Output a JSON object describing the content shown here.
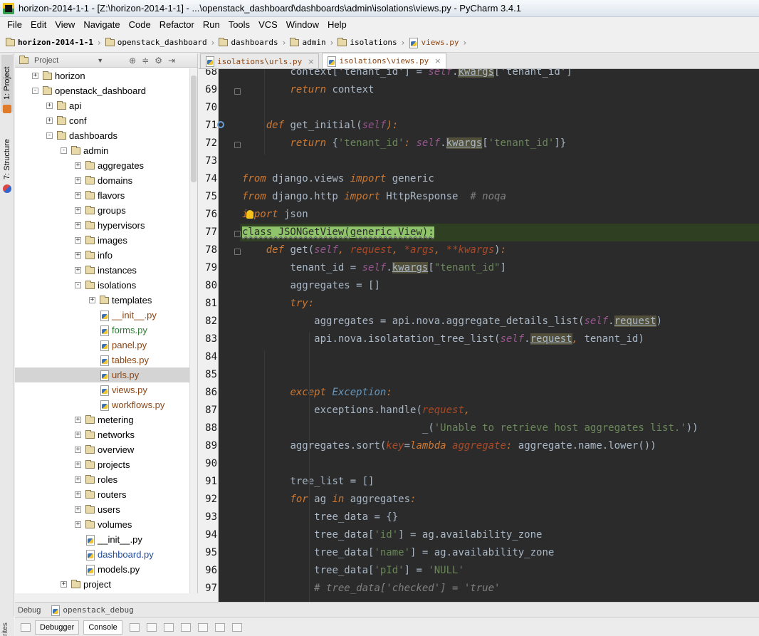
{
  "window": {
    "title": "horizon-2014-1-1 - [Z:\\horizon-2014-1-1] - ...\\openstack_dashboard\\dashboards\\admin\\isolations\\views.py - PyCharm 3.4.1"
  },
  "menu": [
    "File",
    "Edit",
    "View",
    "Navigate",
    "Code",
    "Refactor",
    "Run",
    "Tools",
    "VCS",
    "Window",
    "Help"
  ],
  "breadcrumb": [
    "horizon-2014-1-1",
    "openstack_dashboard",
    "dashboards",
    "admin",
    "isolations",
    "views.py"
  ],
  "left_strip": {
    "project_tab": "1: Project",
    "structure_tab": "7: Structure",
    "bottom_label": "rites"
  },
  "project_panel": {
    "title": "Project",
    "tree": [
      {
        "label": "horizon",
        "type": "folder",
        "depth": 1,
        "expander": "+"
      },
      {
        "label": "openstack_dashboard",
        "type": "folder",
        "depth": 1,
        "expander": "-"
      },
      {
        "label": "api",
        "type": "folder",
        "depth": 2,
        "expander": "+"
      },
      {
        "label": "conf",
        "type": "folder",
        "depth": 2,
        "expander": "+"
      },
      {
        "label": "dashboards",
        "type": "folder",
        "depth": 2,
        "expander": "-"
      },
      {
        "label": "admin",
        "type": "folder",
        "depth": 3,
        "expander": "-"
      },
      {
        "label": "aggregates",
        "type": "folder",
        "depth": 4,
        "expander": "+"
      },
      {
        "label": "domains",
        "type": "folder",
        "depth": 4,
        "expander": "+"
      },
      {
        "label": "flavors",
        "type": "folder",
        "depth": 4,
        "expander": "+"
      },
      {
        "label": "groups",
        "type": "folder",
        "depth": 4,
        "expander": "+"
      },
      {
        "label": "hypervisors",
        "type": "folder",
        "depth": 4,
        "expander": "+"
      },
      {
        "label": "images",
        "type": "folder",
        "depth": 4,
        "expander": "+"
      },
      {
        "label": "info",
        "type": "folder",
        "depth": 4,
        "expander": "+"
      },
      {
        "label": "instances",
        "type": "folder",
        "depth": 4,
        "expander": "+"
      },
      {
        "label": "isolations",
        "type": "folder",
        "depth": 4,
        "expander": "-"
      },
      {
        "label": "templates",
        "type": "folder",
        "depth": 5,
        "expander": "+"
      },
      {
        "label": "__init__.py",
        "type": "file",
        "depth": 5,
        "color": "#8b4513"
      },
      {
        "label": "forms.py",
        "type": "file",
        "depth": 5,
        "color": "#2e7d32"
      },
      {
        "label": "panel.py",
        "type": "file",
        "depth": 5,
        "color": "#8b4513"
      },
      {
        "label": "tables.py",
        "type": "file",
        "depth": 5,
        "color": "#8b4513"
      },
      {
        "label": "urls.py",
        "type": "file",
        "depth": 5,
        "color": "#8b4513",
        "selected": true
      },
      {
        "label": "views.py",
        "type": "file",
        "depth": 5,
        "color": "#8b4513"
      },
      {
        "label": "workflows.py",
        "type": "file",
        "depth": 5,
        "color": "#8b4513"
      },
      {
        "label": "metering",
        "type": "folder",
        "depth": 4,
        "expander": "+"
      },
      {
        "label": "networks",
        "type": "folder",
        "depth": 4,
        "expander": "+"
      },
      {
        "label": "overview",
        "type": "folder",
        "depth": 4,
        "expander": "+"
      },
      {
        "label": "projects",
        "type": "folder",
        "depth": 4,
        "expander": "+"
      },
      {
        "label": "roles",
        "type": "folder",
        "depth": 4,
        "expander": "+"
      },
      {
        "label": "routers",
        "type": "folder",
        "depth": 4,
        "expander": "+"
      },
      {
        "label": "users",
        "type": "folder",
        "depth": 4,
        "expander": "+"
      },
      {
        "label": "volumes",
        "type": "folder",
        "depth": 4,
        "expander": "+"
      },
      {
        "label": "__init__.py",
        "type": "file",
        "depth": 4,
        "color": "#000000"
      },
      {
        "label": "dashboard.py",
        "type": "file",
        "depth": 4,
        "color": "#1f4e9c"
      },
      {
        "label": "models.py",
        "type": "file",
        "depth": 4,
        "color": "#000000"
      },
      {
        "label": "project",
        "type": "folder",
        "depth": 3,
        "expander": "+"
      }
    ]
  },
  "editor_tabs": [
    {
      "label": "isolations\\urls.py",
      "active": false
    },
    {
      "label": "isolations\\views.py",
      "active": true
    }
  ],
  "code": {
    "highlight_line": 77,
    "lines": [
      {
        "n": "68",
        "indent": 2,
        "tokens": [
          [
            "t",
            "context['tenant_id'] = "
          ],
          [
            "self",
            "self"
          ],
          [
            "t",
            "."
          ],
          [
            "ulw",
            "kwargs"
          ],
          [
            "t",
            "['tenant_id']"
          ]
        ]
      },
      {
        "n": "69",
        "indent": 2,
        "fold": true,
        "tokens": [
          [
            "kw",
            "return"
          ],
          [
            "t",
            " context"
          ]
        ]
      },
      {
        "n": "70",
        "indent": 0,
        "tokens": []
      },
      {
        "n": "71",
        "indent": 1,
        "mark": true,
        "tokens": [
          [
            "kw",
            "def"
          ],
          [
            "t",
            " get_initial("
          ],
          [
            "self",
            "self"
          ],
          [
            "kw",
            ")"
          ],
          [
            "kw",
            ":"
          ]
        ]
      },
      {
        "n": "72",
        "indent": 2,
        "fold": true,
        "tokens": [
          [
            "kw",
            "return"
          ],
          [
            "t",
            " {"
          ],
          [
            "str",
            "'tenant_id'"
          ],
          [
            "kw",
            ":"
          ],
          [
            "t",
            " "
          ],
          [
            "self",
            "self"
          ],
          [
            "t",
            "."
          ],
          [
            "ulw",
            "kwargs"
          ],
          [
            "t",
            "["
          ],
          [
            "str",
            "'tenant_id'"
          ],
          [
            "t",
            "]}"
          ]
        ]
      },
      {
        "n": "73",
        "indent": 0,
        "tokens": []
      },
      {
        "n": "74",
        "indent": 0,
        "tokens": [
          [
            "kw",
            "from"
          ],
          [
            "t",
            " django.views "
          ],
          [
            "kw",
            "import"
          ],
          [
            "t",
            " generic"
          ]
        ]
      },
      {
        "n": "75",
        "indent": 0,
        "tokens": [
          [
            "kw",
            "from"
          ],
          [
            "t",
            " django.http "
          ],
          [
            "kw",
            "import"
          ],
          [
            "t",
            " HttpResponse  "
          ],
          [
            "cmt",
            "# noqa"
          ]
        ]
      },
      {
        "n": "76",
        "indent": 0,
        "bulb": true,
        "tokens": [
          [
            "kw",
            "import"
          ],
          [
            "t",
            " json"
          ]
        ]
      },
      {
        "n": "77",
        "indent": 0,
        "fold": true,
        "selected": true,
        "tokens": [
          [
            "sel",
            "class JSONGetView(generic.View):"
          ]
        ]
      },
      {
        "n": "78",
        "indent": 1,
        "fold": true,
        "tokens": [
          [
            "kw",
            "def"
          ],
          [
            "t",
            " get("
          ],
          [
            "self",
            "self"
          ],
          [
            "kw",
            ","
          ],
          [
            "t",
            " "
          ],
          [
            "param",
            "request"
          ],
          [
            "kw",
            ","
          ],
          [
            "t",
            " "
          ],
          [
            "param",
            "*args"
          ],
          [
            "kw",
            ","
          ],
          [
            "t",
            " "
          ],
          [
            "param",
            "**kwargs"
          ],
          [
            "t",
            ")"
          ],
          [
            "kw",
            ":"
          ]
        ]
      },
      {
        "n": "79",
        "indent": 2,
        "tokens": [
          [
            "t",
            "tenant_id = "
          ],
          [
            "self",
            "self"
          ],
          [
            "t",
            "."
          ],
          [
            "ulw",
            "kwargs"
          ],
          [
            "t",
            "["
          ],
          [
            "str",
            "\"tenant_id\""
          ],
          [
            "t",
            "]"
          ]
        ]
      },
      {
        "n": "80",
        "indent": 2,
        "tokens": [
          [
            "t",
            "aggregates = []"
          ]
        ]
      },
      {
        "n": "81",
        "indent": 2,
        "tokens": [
          [
            "kw",
            "try"
          ],
          [
            "kw",
            ":"
          ]
        ]
      },
      {
        "n": "82",
        "indent": 3,
        "tokens": [
          [
            "t",
            "aggregates = api.nova.aggregate_details_list("
          ],
          [
            "self",
            "self"
          ],
          [
            "t",
            "."
          ],
          [
            "ulw",
            "request"
          ],
          [
            "t",
            ")"
          ]
        ]
      },
      {
        "n": "83",
        "indent": 3,
        "tokens": [
          [
            "t",
            "api.nova.isolatation_tree_list("
          ],
          [
            "self",
            "self"
          ],
          [
            "t",
            "."
          ],
          [
            "ulw",
            "request"
          ],
          [
            "kw",
            ","
          ],
          [
            "t",
            " tenant_id)"
          ]
        ]
      },
      {
        "n": "84",
        "indent": 0,
        "tokens": []
      },
      {
        "n": "85",
        "indent": 0,
        "tokens": []
      },
      {
        "n": "86",
        "indent": 2,
        "tokens": [
          [
            "kw",
            "except"
          ],
          [
            "t",
            " "
          ],
          [
            "kwn",
            "Exception"
          ],
          [
            "kw",
            ":"
          ]
        ]
      },
      {
        "n": "87",
        "indent": 3,
        "tokens": [
          [
            "t",
            "exceptions.handle("
          ],
          [
            "param",
            "request"
          ],
          [
            "kw",
            ","
          ]
        ]
      },
      {
        "n": "88",
        "indent": 3,
        "pad": "                  ",
        "tokens": [
          [
            "t",
            "_("
          ],
          [
            "str",
            "'Unable to retrieve host aggregates list.'"
          ],
          [
            "t",
            "))"
          ]
        ]
      },
      {
        "n": "89",
        "indent": 2,
        "tokens": [
          [
            "t",
            "aggregates.sort("
          ],
          [
            "param",
            "key"
          ],
          [
            "t",
            "="
          ],
          [
            "kw",
            "lambda"
          ],
          [
            "t",
            " "
          ],
          [
            "param",
            "aggregate"
          ],
          [
            "kw",
            ":"
          ],
          [
            "t",
            " aggregate.name.lower())"
          ]
        ]
      },
      {
        "n": "90",
        "indent": 0,
        "tokens": []
      },
      {
        "n": "91",
        "indent": 2,
        "tokens": [
          [
            "t",
            "tree_list = []"
          ]
        ]
      },
      {
        "n": "92",
        "indent": 2,
        "tokens": [
          [
            "kw",
            "for"
          ],
          [
            "t",
            " ag "
          ],
          [
            "kw",
            "in"
          ],
          [
            "t",
            " aggregates"
          ],
          [
            "kw",
            ":"
          ]
        ]
      },
      {
        "n": "93",
        "indent": 3,
        "tokens": [
          [
            "t",
            "tree_data = {}"
          ]
        ]
      },
      {
        "n": "94",
        "indent": 3,
        "tokens": [
          [
            "t",
            "tree_data["
          ],
          [
            "str",
            "'id'"
          ],
          [
            "t",
            "] = ag.availability_zone"
          ]
        ]
      },
      {
        "n": "95",
        "indent": 3,
        "tokens": [
          [
            "t",
            "tree_data["
          ],
          [
            "str",
            "'name'"
          ],
          [
            "t",
            "] = ag.availability_zone"
          ]
        ]
      },
      {
        "n": "96",
        "indent": 3,
        "tokens": [
          [
            "t",
            "tree_data["
          ],
          [
            "str",
            "'pId'"
          ],
          [
            "t",
            "] = "
          ],
          [
            "str",
            "'NULL'"
          ]
        ]
      },
      {
        "n": "97",
        "indent": 3,
        "tokens": [
          [
            "cmt",
            "# tree_data['checked'] = 'true'"
          ]
        ]
      }
    ]
  },
  "debug": {
    "label": "Debug",
    "session": "openstack_debug",
    "tabs": [
      "Debugger",
      "Console"
    ]
  }
}
